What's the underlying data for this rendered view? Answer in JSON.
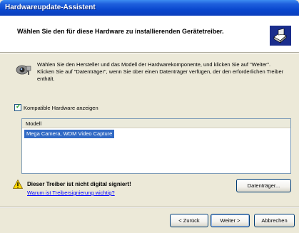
{
  "window": {
    "title": "Hardwareupdate-Assistent"
  },
  "header": {
    "title": "Wählen Sie den für diese Hardware zu installierenden Gerätetreiber."
  },
  "info": {
    "text": "Wählen Sie den Hersteller und das Modell der Hardwarekomponente, und klicken Sie auf \"Weiter\". Klicken Sie auf \"Datenträger\", wenn Sie über einen Datenträger verfügen, der den erforderlichen Treiber enthält."
  },
  "compatible": {
    "label": "Kompatible Hardware anzeigen",
    "checked": true
  },
  "model_list": {
    "column_header": "Modell",
    "items": [
      "Mega Camera, WDM Video Capture"
    ]
  },
  "warning": {
    "title": "Dieser Treiber ist nicht digital signiert!",
    "link": "Warum ist Treibersignierung wichtig?"
  },
  "buttons": {
    "disk": "Datenträger...",
    "back": "< Zurück",
    "next": "Weiter >",
    "cancel": "Abbrechen"
  },
  "icons": {
    "header": "hardware-install-icon",
    "info": "camera-icon",
    "warning": "warning-icon"
  },
  "colors": {
    "titlebar": "#0a48cf",
    "selection": "#316ac5",
    "dialog_bg": "#ece9d8"
  }
}
